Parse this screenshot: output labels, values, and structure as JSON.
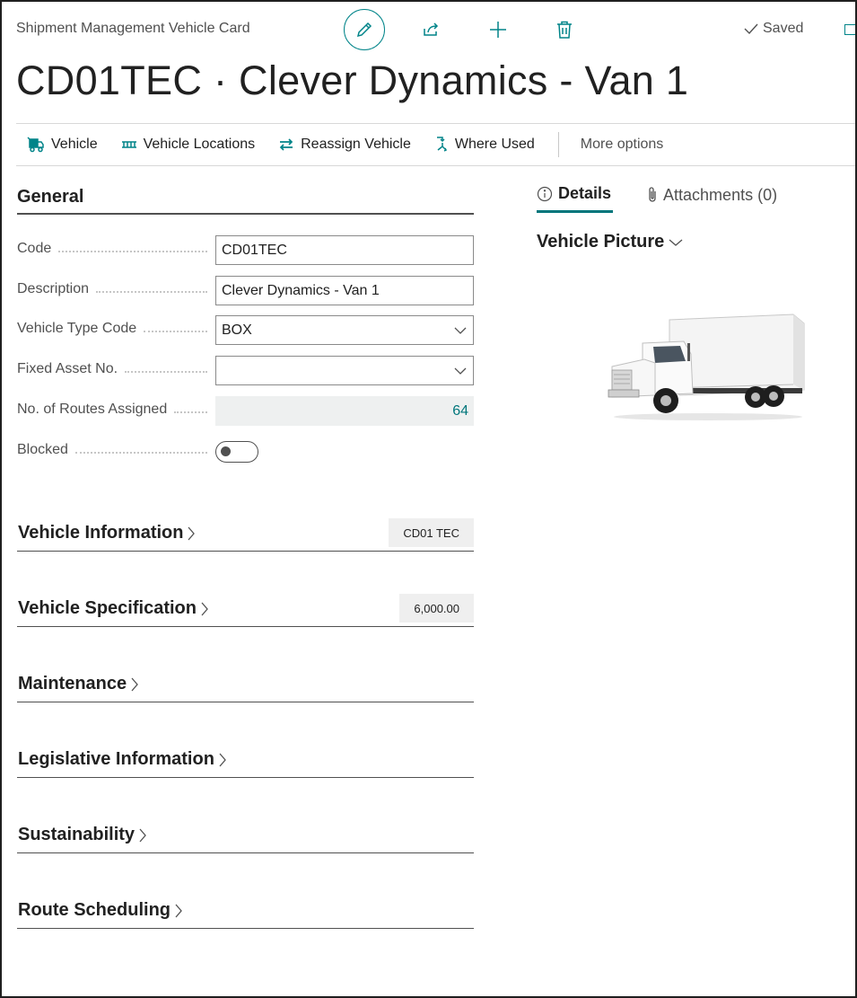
{
  "header": {
    "caption": "Shipment Management Vehicle Card",
    "saved_status": "Saved",
    "title": "CD01TEC · Clever Dynamics - Van 1"
  },
  "actions": [
    {
      "label": "Vehicle",
      "icon": "vehicle-icon"
    },
    {
      "label": "Vehicle Locations",
      "icon": "locations-icon"
    },
    {
      "label": "Reassign Vehicle",
      "icon": "reassign-icon"
    },
    {
      "label": "Where Used",
      "icon": "where-used-icon"
    }
  ],
  "more_options": "More options",
  "general": {
    "title": "General",
    "fields": {
      "code": {
        "label": "Code",
        "value": "CD01TEC"
      },
      "description": {
        "label": "Description",
        "value": "Clever Dynamics - Van 1"
      },
      "vehicle_type": {
        "label": "Vehicle Type Code",
        "value": "BOX"
      },
      "fixed_asset": {
        "label": "Fixed Asset No.",
        "value": ""
      },
      "routes_assigned": {
        "label": "No. of Routes Assigned",
        "value": "64"
      },
      "blocked": {
        "label": "Blocked",
        "value": false
      }
    }
  },
  "sections": {
    "vehicle_information": {
      "title": "Vehicle Information",
      "badge": "CD01 TEC"
    },
    "vehicle_specification": {
      "title": "Vehicle Specification",
      "badge": "6,000.00"
    },
    "maintenance": {
      "title": "Maintenance"
    },
    "legislative": {
      "title": "Legislative Information"
    },
    "sustainability": {
      "title": "Sustainability"
    },
    "route_scheduling": {
      "title": "Route Scheduling"
    }
  },
  "factbox": {
    "tabs": {
      "details": "Details",
      "attachments": "Attachments (0)"
    },
    "picture_title": "Vehicle Picture"
  },
  "colors": {
    "accent": "#008489",
    "text": "#212121",
    "muted": "#505050"
  }
}
